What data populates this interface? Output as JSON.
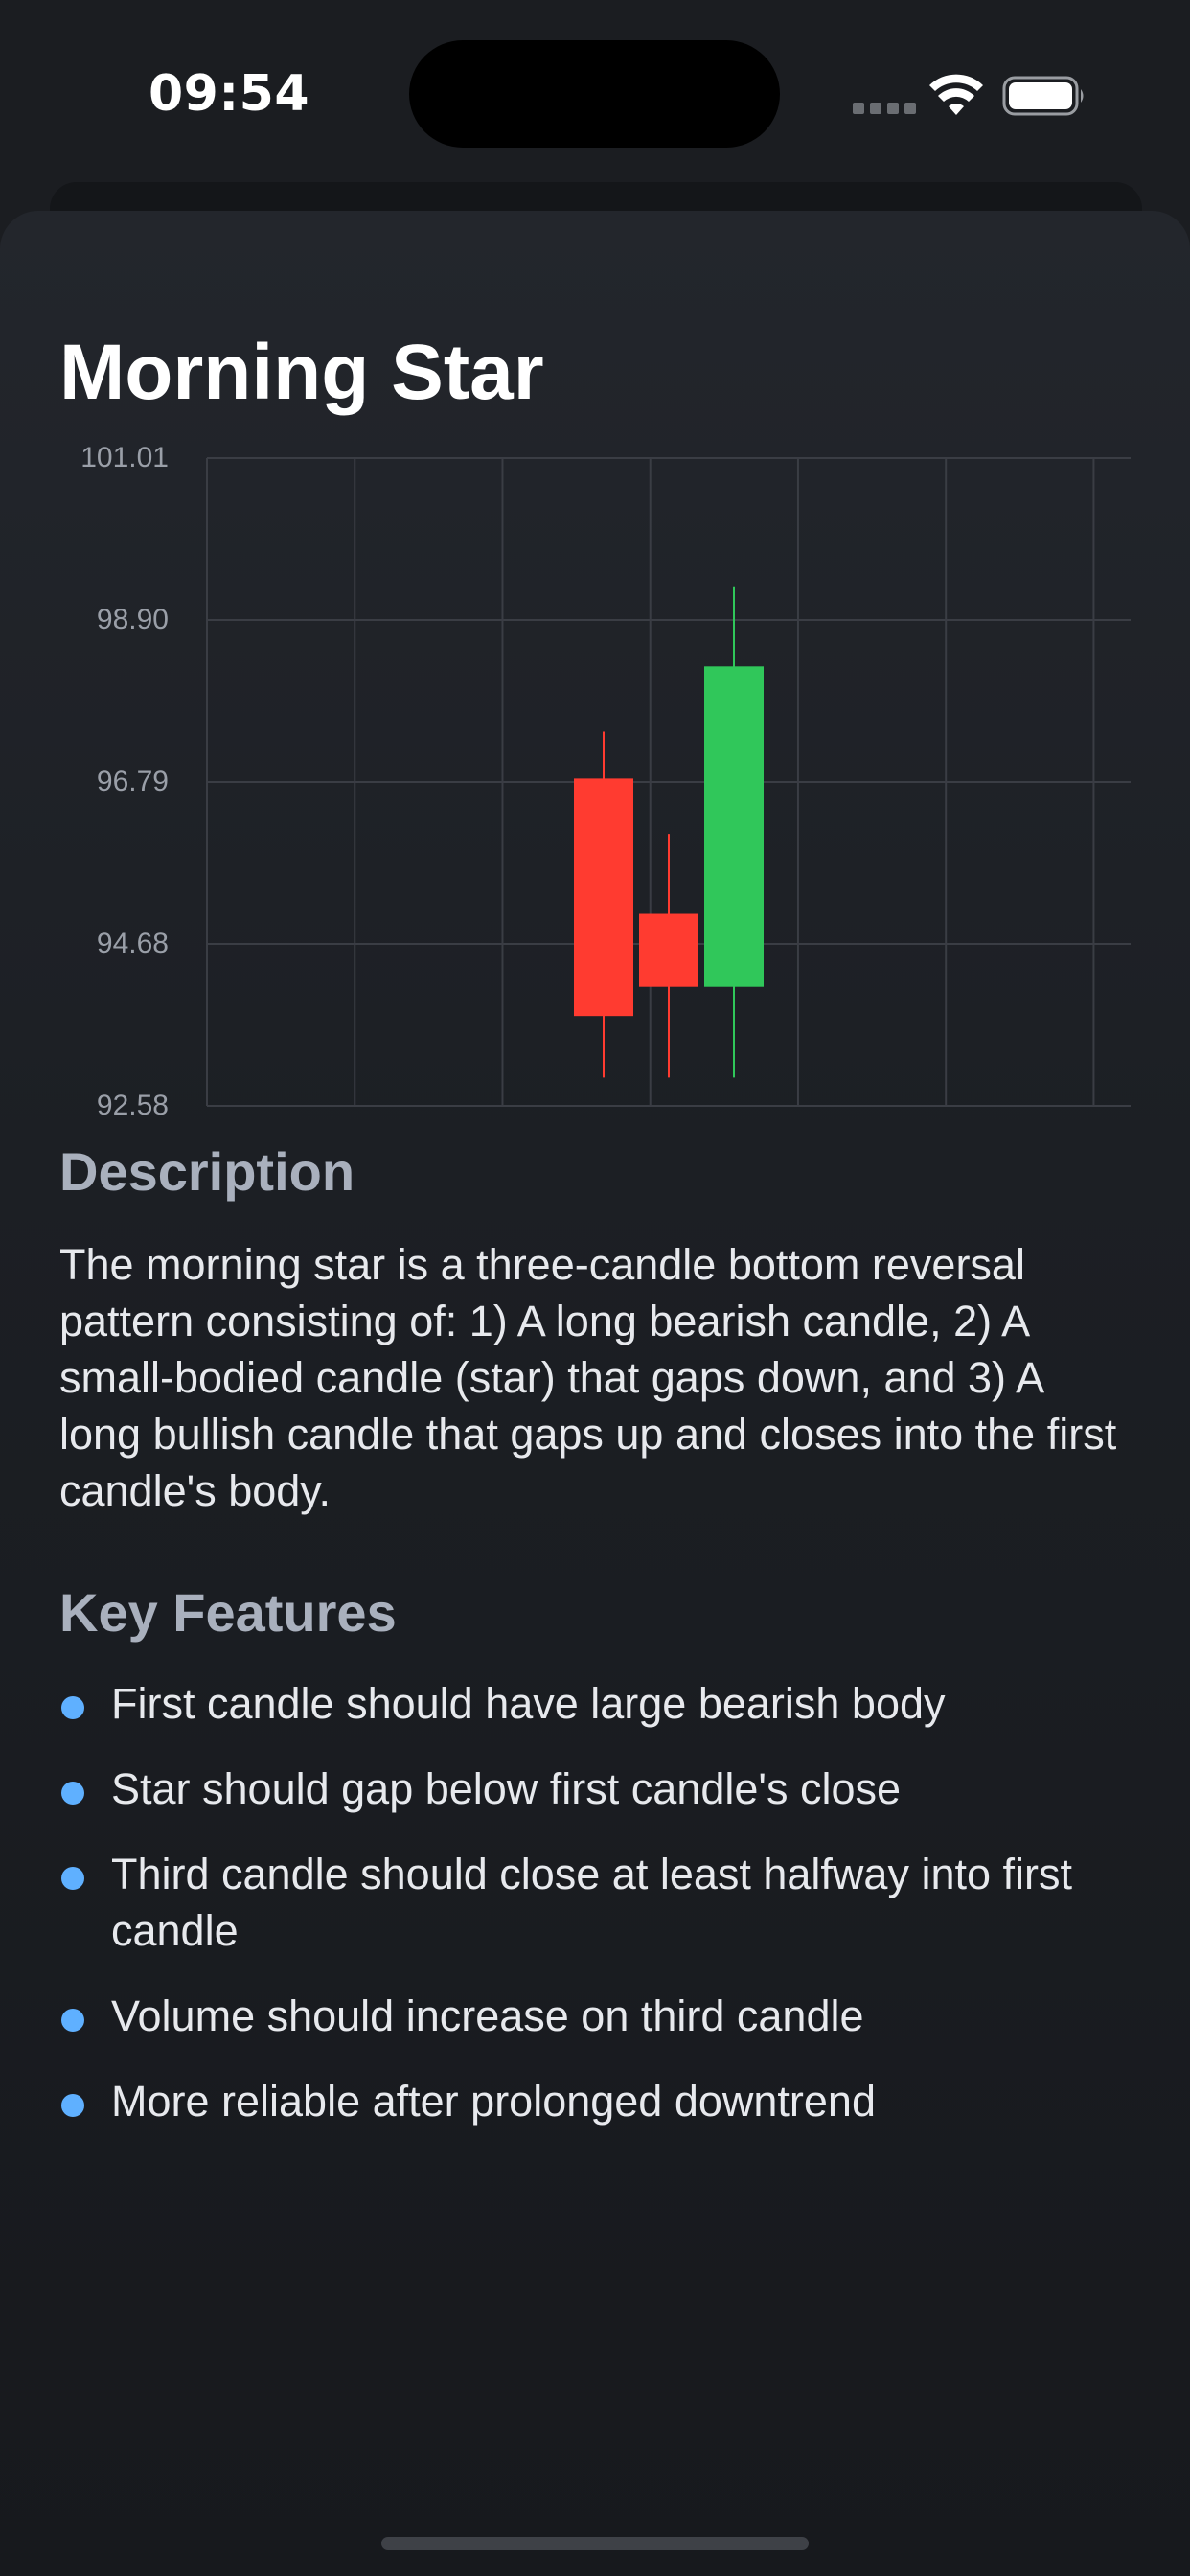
{
  "status_bar": {
    "time": "09:54"
  },
  "pattern": {
    "title": "Morning Star"
  },
  "chart_data": {
    "type": "candlestick",
    "y_tick_labels": [
      "101.01",
      "98.90",
      "96.79",
      "94.68",
      "92.58"
    ],
    "ylim": [
      92.58,
      101.01
    ],
    "grid": true,
    "candles": [
      {
        "open": 96.84,
        "high": 97.45,
        "low": 92.95,
        "close": 93.75,
        "direction": "bearish"
      },
      {
        "open": 95.08,
        "high": 96.12,
        "low": 92.95,
        "close": 94.13,
        "direction": "bearish"
      },
      {
        "open": 94.13,
        "high": 99.33,
        "low": 92.95,
        "close": 98.3,
        "direction": "bullish"
      }
    ],
    "colors": {
      "bearish": "#ff3b30",
      "bullish": "#30c75a",
      "grid": "#3a3d44",
      "tick": "#9a9fa8"
    }
  },
  "description": {
    "heading": "Description",
    "text": "The morning star is a three-candle bottom reversal pattern consisting of: 1) A long bearish candle, 2) A small-bodied candle (star) that gaps down, and 3) A long bullish candle that gaps up and closes into the first candle's body."
  },
  "key_features": {
    "heading": "Key Features",
    "bullet_color": "#5fb0ff",
    "items": [
      "First candle should have large bearish body",
      "Star should gap below first candle's close",
      "Third candle should close at least halfway into first candle",
      "Volume should increase on third candle",
      "More reliable after prolonged downtrend"
    ]
  }
}
